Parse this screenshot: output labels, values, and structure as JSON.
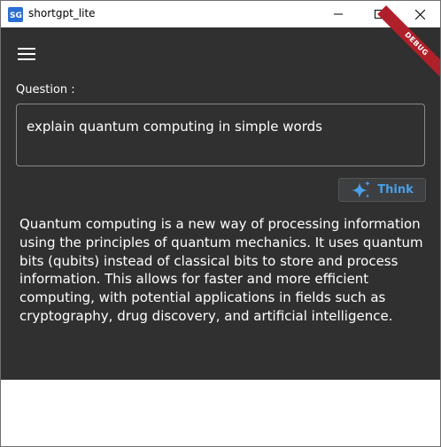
{
  "window": {
    "title": "shortgpt_lite",
    "app_icon": "shortgpt-app-icon",
    "controls": [
      "minimize-icon",
      "maximize-icon",
      "close-icon"
    ]
  },
  "app": {
    "menu_icon": "hamburger-menu-icon",
    "debug_banner": "DEBUG"
  },
  "question": {
    "label": "Question :",
    "value": "explain quantum computing in simple words"
  },
  "think_button": {
    "label": "Think",
    "icon": "sparkle-icon",
    "color": "#4a9fe8"
  },
  "answer": {
    "text": "Quantum computing is a new way of processing information using the principles of quantum mechanics. It uses quantum bits (qubits) instead of classical bits to store and process information. This allows for faster and more efficient computing, with potential applications in fields such as cryptography, drug discovery, and artificial intelligence."
  },
  "colors": {
    "background": "#303030",
    "text": "#ffffff",
    "accent": "#4a9fe8",
    "debug_ribbon": "#b0202a"
  }
}
